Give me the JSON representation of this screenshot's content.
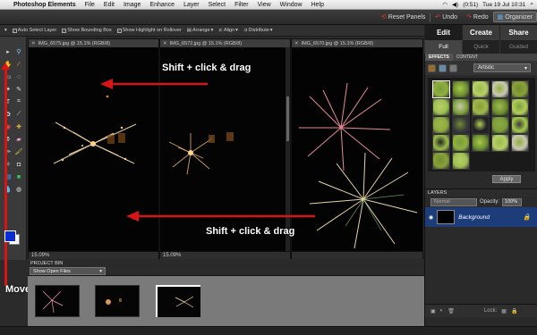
{
  "menubar": {
    "app_name": "Photoshop Elements",
    "items": [
      "File",
      "Edit",
      "Image",
      "Enhance",
      "Layer",
      "Select",
      "Filter",
      "View",
      "Window",
      "Help"
    ],
    "battery": "(0:51)",
    "datetime": "Tue 19 Jul  10:31"
  },
  "toolbar": {
    "reset_panels": "Reset Panels",
    "undo": "Undo",
    "redo": "Redo",
    "organizer": "Organizer"
  },
  "mode_tabs": [
    {
      "label": "Edit",
      "active": true
    },
    {
      "label": "Create",
      "active": false
    },
    {
      "label": "Share",
      "active": false
    }
  ],
  "sub_tabs": [
    {
      "label": "Full",
      "active": true
    },
    {
      "label": "Quick",
      "active": false
    },
    {
      "label": "Guided",
      "active": false
    }
  ],
  "options_bar": {
    "auto_select": "Auto Select Layer",
    "bounding_box": "Show Bounding Box",
    "highlight": "Show Highlight on Rollover",
    "arrange": "Arrange",
    "align": "Align",
    "distribute": "Distribute"
  },
  "documents": [
    {
      "tab": "IMG_6575.jpg @ 15.1% (RGB/8)",
      "zoom": "15.09%"
    },
    {
      "tab": "IMG_6572.jpg @ 15.1% (RGB/8)",
      "zoom": "15.09%"
    },
    {
      "tab": "IMG_6570.jpg @ 15.1% (RGB/8)",
      "zoom": ""
    }
  ],
  "annotations": {
    "top": "Shift + click & drag",
    "bottom": "Shift + click & drag",
    "move_tool": "Move tool"
  },
  "project_bin": {
    "title": "PROJECT BIN",
    "filter": "Show Open Files"
  },
  "effects_panel": {
    "tab_effects": "EFFECTS",
    "tab_content": "CONTENT",
    "category": "Artistic",
    "apply": "Apply"
  },
  "layers_panel": {
    "title": "LAYERS",
    "blend_mode": "Normal",
    "opacity_label": "Opacity:",
    "opacity_value": "100%",
    "layer_name": "Background",
    "lock_label": "Lock:"
  },
  "colors": {
    "accent_red": "#d81414",
    "foreground_swatch": "#0a2bd8",
    "layer_selection": "#1d3c7a"
  }
}
